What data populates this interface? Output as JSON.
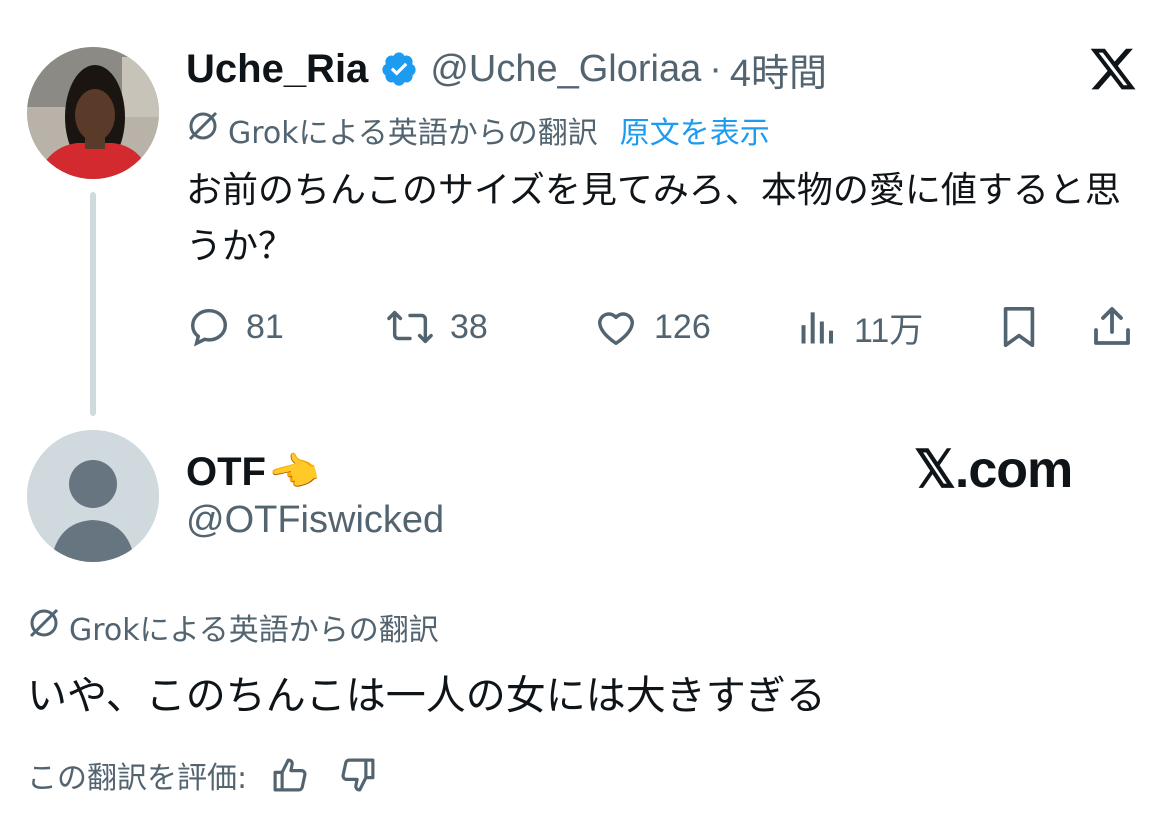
{
  "tweet": {
    "author_name": "Uche_Ria",
    "author_handle": "@Uche_Gloriaa",
    "time_separator": "·",
    "time": "4時間",
    "translation_notice": "Grokによる英語からの翻訳",
    "show_original": "原文を表示",
    "text": "お前のちんこのサイズを見てみろ、本物の愛に値すると思うか？",
    "metrics": {
      "replies": "81",
      "reposts": "38",
      "likes": "126",
      "views": "11万"
    },
    "verified_color": "#1d9bf0"
  },
  "reply": {
    "author_name": "OTF",
    "author_emoji": "👉",
    "author_handle": "@OTFiswicked",
    "site_label": "𝕏.com",
    "translation_notice": "Grokによる英語からの翻訳",
    "text": "いや、このちんこは一人の女には大きすぎる",
    "rate_label": "この翻訳を評価:"
  },
  "colors": {
    "text": "#0f1419",
    "secondary": "#536471",
    "link": "#1d9bf0",
    "thread_line": "#cfd9de"
  }
}
